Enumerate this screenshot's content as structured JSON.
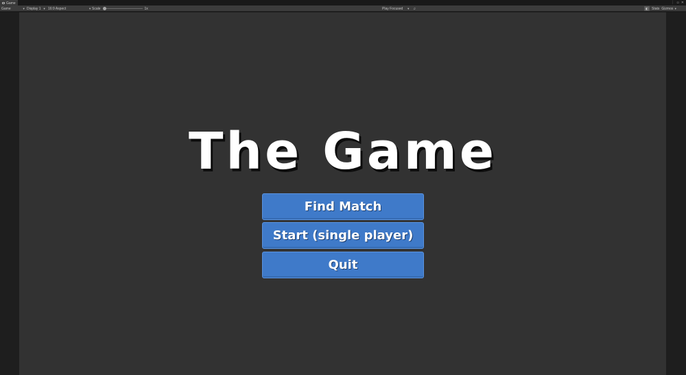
{
  "window": {
    "tab_label": "Game",
    "tab_icon": "gamepad-icon"
  },
  "toolbar": {
    "view_mode": "Game",
    "display": "Display 1",
    "aspect": "16:9 Aspect",
    "scale_label": "Scale",
    "scale_value": "1x",
    "play_mode": "Play Focused",
    "stats_label": "Stats",
    "gizmos_label": "Gizmos"
  },
  "game": {
    "title": "The Game",
    "buttons": [
      {
        "label": "Find Match"
      },
      {
        "label": "Start (single player)"
      },
      {
        "label": "Quit"
      }
    ]
  },
  "colors": {
    "button_bg": "#3f7ac9",
    "view_bg": "#323232",
    "title_color": "#ffffff"
  }
}
